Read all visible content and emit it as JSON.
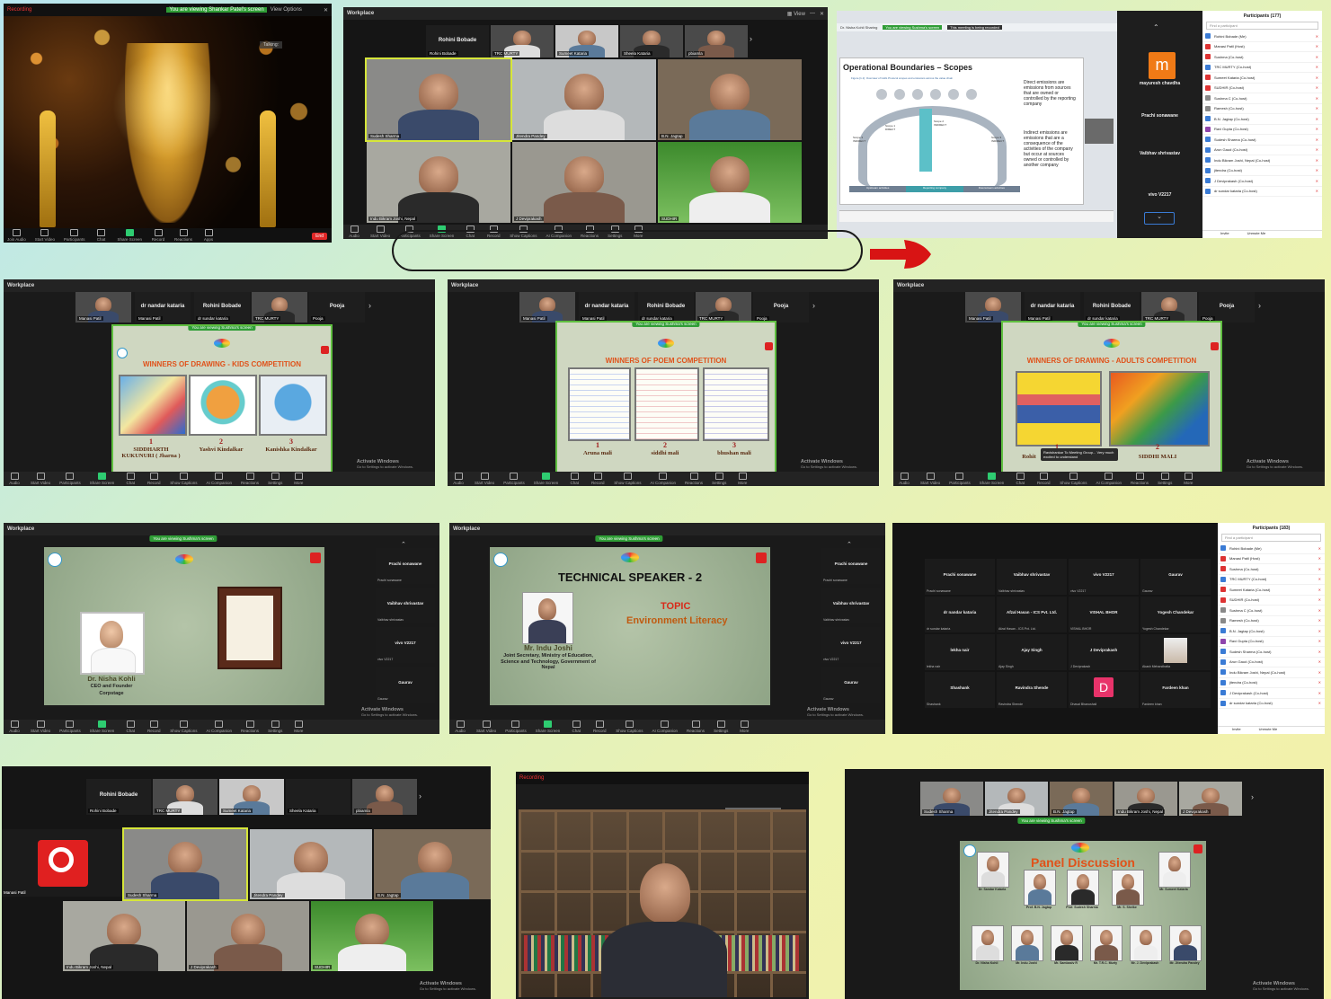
{
  "collage": {
    "oval_arrow_color": "#d81414"
  },
  "panel1": {
    "rec_label": "Recording",
    "sharing_banner": "You are viewing Shankar Patel's screen",
    "view_options": "View Options",
    "talking": "Talking:",
    "toolbar": [
      "Join Audio",
      "Start Video",
      "Participants",
      "Chat",
      "Share Screen",
      "Record",
      "Reactions",
      "Apps"
    ],
    "end": "End"
  },
  "panel2": {
    "app_title": "Workplace",
    "speakers": [
      "Rohini Bobade",
      "TRC MURTY",
      "Sumeet Kataria",
      "Sheela Kataria",
      "pbiamla"
    ],
    "grid": [
      "Sudesh Sharma",
      "Jitendra Pandey",
      "B.N. Jagtap",
      "Indu Bikram Joshi, Nepal",
      "J Deviprakash",
      "SUDHIR"
    ],
    "toolbar": [
      "Audio",
      "Start Video",
      "Participants",
      "Share Screen",
      "Chat",
      "Record",
      "Show Captions",
      "AI Companion",
      "Reactions",
      "Settings",
      "More"
    ]
  },
  "panel3": {
    "banner_left": "Dr. Nisha Kohli Sharing",
    "banner": "You are viewing Sushma's screen",
    "banner_record": "This meeting is being recorded",
    "slide_title": "Operational Boundaries – Scopes",
    "figure_caption": "Figure [1.1]: Overview of GHG Protocol scopes and emissions across the value chain",
    "direct": "Direct emissions are emissions from sources that are owned or controlled by the reporting company",
    "indirect": "Indirect emissions are emissions that are a consequence of the activities of the company but occur at sources owned or controlled by another company",
    "scope1": "Scope 1 DIRECT",
    "scope2": "Scope 2 INDIRECT",
    "scope3a": "Scope 3 INDIRECT",
    "scope3b": "Scope 3 INDIRECT",
    "band1": "Upstream activities",
    "band2": "Reporting company",
    "band3": "Downstream activities",
    "side_avatar_letter": "m",
    "side_names": [
      "mayuresh chavdha",
      "Prachi sonawane",
      "Vaibhav shrivastav",
      "vivo V2217"
    ],
    "participants_title": "Participants (177)",
    "find": "Find a participant",
    "participants": [
      {
        "n": "Rohini Bobade (Me)",
        "c": "#3a7bd5"
      },
      {
        "n": "Manasi Patil (Host)",
        "c": "#d33"
      },
      {
        "n": "Sushma (Co-host)",
        "c": "#d33"
      },
      {
        "n": "TRC MURTY (Co-host)",
        "c": "#3a7bd5"
      },
      {
        "n": "Sumeet Kataria (Co-host)",
        "c": "#d33"
      },
      {
        "n": "SUDHIR (Co-host)",
        "c": "#d33"
      },
      {
        "n": "Sushma C (Co-host)",
        "c": "#888"
      },
      {
        "n": "Ramesh (Co-host)",
        "c": "#888"
      },
      {
        "n": "B.N. Jagtap (Co-host)",
        "c": "#3a7bd5"
      },
      {
        "n": "Ravi Gupta (Co-host)",
        "c": "#8e44ad"
      },
      {
        "n": "Sudesh Sharma (Co-host)",
        "c": "#3a7bd5"
      },
      {
        "n": "Arun Gaud (Co-host)",
        "c": "#3a7bd5"
      },
      {
        "n": "Indu Bikram Joshi, Nepal (Co-host)",
        "c": "#3a7bd5"
      },
      {
        "n": "jitendra (Co-host)",
        "c": "#3a7bd5"
      },
      {
        "n": "J Deviprakash (Co-host)",
        "c": "#3a7bd5"
      },
      {
        "n": "dr sundar kataria (Co-host)",
        "c": "#3a7bd5"
      }
    ],
    "btn_invite": "Invite",
    "btn_unmute": "Unmute Me"
  },
  "header_strip": {
    "names": [
      "dr nandar kataria",
      "Rohini Bobade",
      "Pooja"
    ],
    "sub": [
      "Manasi Patil",
      "dr sundar kataria",
      "Rohini Bobade",
      "TRC MURTY",
      "Pooja"
    ],
    "view_options": "View Options",
    "viewing": "You are viewing Sushma's screen"
  },
  "kids": {
    "title": "WINNERS OF DRAWING - KIDS COMPETITION",
    "winners": [
      {
        "rank": "1",
        "name": "SIDDHARTH KUKUNURI ( Jharna )"
      },
      {
        "rank": "2",
        "name": "Yashvi Kindalkar"
      },
      {
        "rank": "3",
        "name": "Kanishka Kindalkar"
      }
    ]
  },
  "poem": {
    "title": "WINNERS OF POEM COMPETITION",
    "winners": [
      {
        "rank": "1",
        "name": "Aruna mali"
      },
      {
        "rank": "2",
        "name": "siddhi mali"
      },
      {
        "rank": "3",
        "name": "bhushan mali"
      }
    ]
  },
  "adults": {
    "title": "WINNERS OF DRAWING - ADULTS COMPETITION",
    "winners": [
      {
        "rank": "1",
        "name": "Rohit"
      },
      {
        "rank": "2",
        "name": "SIDDHI MALI"
      }
    ],
    "chat_popup": "Ravishankar To Meeting Group... Very much excited to understand"
  },
  "nisha": {
    "speaker_name": "Dr. Nisha Kohli",
    "speaker_role": "CEO and Founder",
    "speaker_org": "Corpstage",
    "side": [
      {
        "n": "Prachi sonawane",
        "s": "Prachi sonawane"
      },
      {
        "n": "Vaibhav shrivastav",
        "s": "Vaibhav shrivastav"
      },
      {
        "n": "vivo V2217",
        "s": "vivo V2217"
      },
      {
        "n": "Gaurav",
        "s": "Gaurav"
      }
    ]
  },
  "tech": {
    "title": "TECHNICAL SPEAKER - 2",
    "topic_label": "TOPIC",
    "topic": "Environment Literacy",
    "name": "Mr. Indu Joshi",
    "role": "Joint Secretary, Ministry of Education, Science and Technology, Government of Nepal"
  },
  "gallery": {
    "tiles": [
      {
        "n": "Prachi sonawane",
        "s": "Prachi sonawane"
      },
      {
        "n": "Vaibhav shrivastav",
        "s": "Vaibhav shrivastav"
      },
      {
        "n": "vivo V2217",
        "s": "vivo V2217"
      },
      {
        "n": "Gaurav",
        "s": "Gaurav"
      },
      {
        "n": "dr nandar kataria",
        "s": "dr sundar kataria"
      },
      {
        "n": "Afzal Hasan - ICS Pvt. Ltd.",
        "s": "Afzal Hasan - ICS Pvt. Ltd."
      },
      {
        "n": "VISHAL BHOR",
        "s": "VISHAL BHOR"
      },
      {
        "n": "Yogesh Chandekar",
        "s": "Yogesh Chandekar"
      },
      {
        "n": "lekha nair",
        "s": "lekha nair"
      },
      {
        "n": "Ajay Singh",
        "s": "Ajay Singh"
      },
      {
        "n": "J Deviprakash",
        "s": "J Deviprakash"
      },
      {
        "n": "",
        "s": "Akash Mehandiratta"
      },
      {
        "n": "Shashank",
        "s": "Shashank"
      },
      {
        "n": "Ravindra Shende",
        "s": "Ravindra Shende"
      },
      {
        "n": "D",
        "s": "Dhaval Bhanushali"
      },
      {
        "n": "Fardeen khan",
        "s": "Fardeen khan"
      }
    ],
    "participants_title": "Participants (183)"
  },
  "panel10": {
    "top": [
      "Rohini Bobade",
      "TRC MURTY",
      "Sumeet Kataria",
      "Sheela Kataria",
      "pbiamla"
    ],
    "left_name": "Manasi Patil",
    "grid": [
      "Sudesh Sharma",
      "Jitendra Pandey",
      "B.N. Jagtap",
      "Indu Bikram Joshi, Nepal",
      "J Deviprakash",
      "SUDHIR"
    ]
  },
  "panel11": {
    "rec": "Recording"
  },
  "panel12": {
    "strip": [
      "Sudesh Sharma",
      "Jitendra Pandey",
      "B.N. Jagtap",
      "Indu Bikram Joshi, Nepal",
      "J Deviprakash"
    ],
    "title": "Panel Discussion",
    "row1": [
      "Dr. Sandar Kataria",
      "Prof. B.N. Jagtap",
      "Prof. Sudesh Sharma",
      "Mr. S. Shelke",
      "Mr. Sumeet Kataria"
    ],
    "row2": [
      "Dr. Nisha Kohli",
      "Mr. Indu Joshi",
      "Mr. Sambasiv R",
      "Mr. T.R.C. Murty",
      "Mr. J. Deviprakash",
      "Mr. Jitendra Pandey"
    ]
  },
  "activate": {
    "line1": "Activate Windows",
    "line2": "Go to Settings to activate Windows."
  }
}
